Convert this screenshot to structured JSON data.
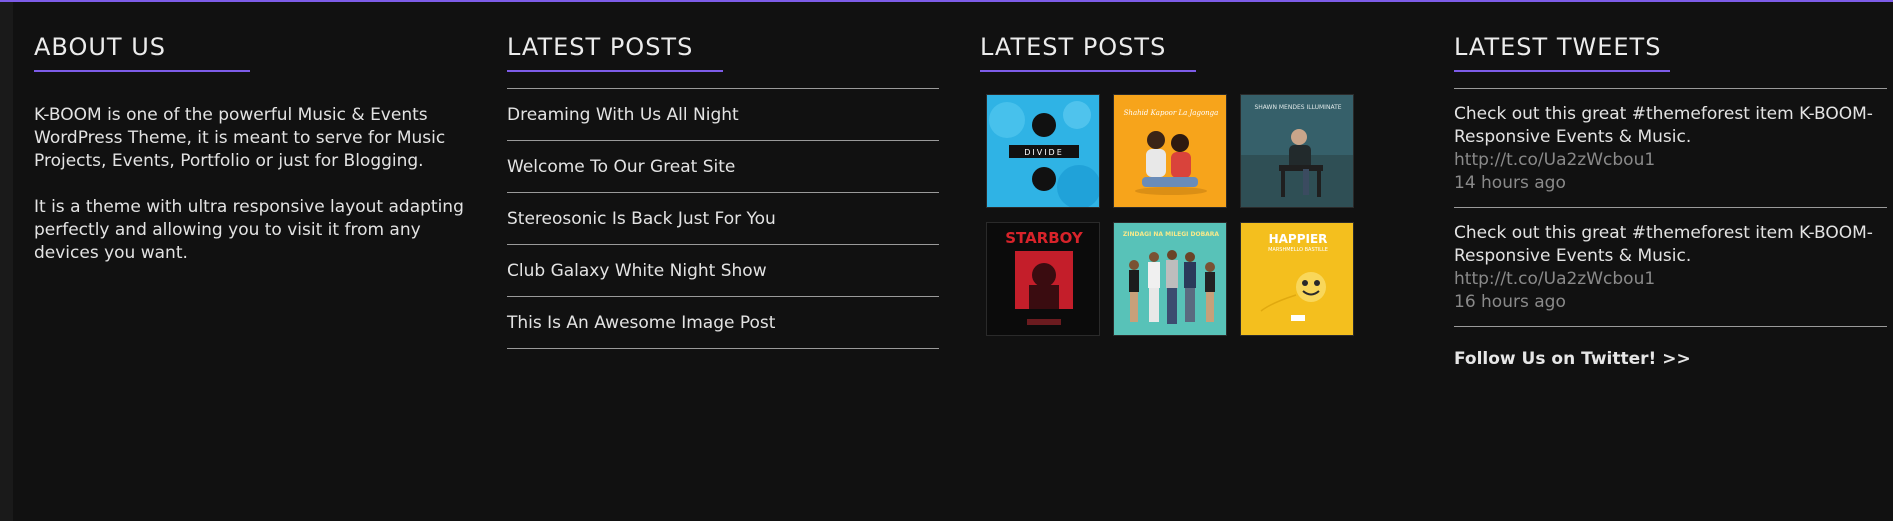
{
  "theme": {
    "accent": "#7d5ce8",
    "background": "#111111"
  },
  "about": {
    "heading": "ABOUT US",
    "paragraphs": [
      "K-BOOM is one of the powerful Music & Events WordPress Theme, it is meant to serve for Music Projects, Events, Portfolio or just for Blogging.",
      "It is a theme with ultra responsive layout adapting perfectly and allowing you to visit it from any devices you want."
    ]
  },
  "latest_posts": {
    "heading": "LATEST POSTS",
    "items": [
      "Dreaming With Us All Night",
      "Welcome To Our Great Site",
      "Stereosonic Is Back Just For You",
      "Club Galaxy White Night Show",
      "This Is An Awesome Image Post"
    ]
  },
  "gallery": {
    "heading": "LATEST POSTS",
    "thumbs": [
      {
        "name": "divide-album-cover",
        "text": "DIVIDE"
      },
      {
        "name": "la-bayadere-cover",
        "text": "Shahid Kapoor La Jagonga"
      },
      {
        "name": "illuminate-album-cover",
        "text": "SHAWN MENDES ILLUMINATE"
      },
      {
        "name": "starboy-album-cover",
        "text": "STARBOY"
      },
      {
        "name": "zindagi-cover",
        "text": "ZINDAGI NA MILEGI DOBARA"
      },
      {
        "name": "happier-cover",
        "text": "HAPPIER",
        "sub": "MARSHMELLO BASTILLE"
      }
    ]
  },
  "tweets": {
    "heading": "LATEST TWEETS",
    "items": [
      {
        "text": "Check out this great #themeforest item K-BOOM-Responsive Events & Music.",
        "link": "http://t.co/Ua2zWcbou1",
        "time": "14 hours ago"
      },
      {
        "text": "Check out this great #themeforest item K-BOOM-Responsive Events & Music.",
        "link": "http://t.co/Ua2zWcbou1",
        "time": "16 hours ago"
      }
    ],
    "follow_label": "Follow Us on Twitter! >>"
  }
}
